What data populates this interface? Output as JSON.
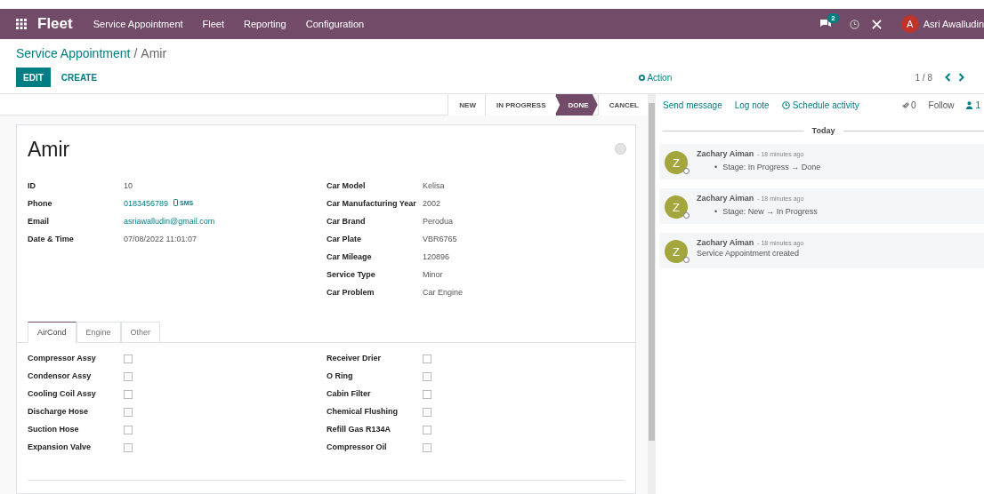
{
  "navbar": {
    "app_name": "Fleet",
    "menu": [
      "Service Appointment",
      "Fleet",
      "Reporting",
      "Configuration"
    ],
    "messages_badge": "2",
    "user": {
      "initial": "A",
      "name": "Asri Awalludin"
    }
  },
  "breadcrumb": {
    "parent": "Service Appointment",
    "separator": "/",
    "current": "Amir"
  },
  "buttons": [
    {
      "label": "EDIT",
      "kind": "primary"
    },
    {
      "label": "CREATE",
      "kind": "secondary"
    }
  ],
  "action": "Action",
  "pager": "1 / 8",
  "stages": [
    {
      "label": "NEW",
      "selected": false
    },
    {
      "label": "IN PROGRESS",
      "selected": false
    },
    {
      "label": "DONE",
      "selected": true
    },
    {
      "label": "CANCEL",
      "selected": false
    }
  ],
  "record": {
    "name": "Amir",
    "left_fields": [
      {
        "label": "ID",
        "value": "10",
        "kind": "text"
      },
      {
        "label": "Phone",
        "value": "0183456789",
        "kind": "phone",
        "extra": "SMS"
      },
      {
        "label": "Email",
        "value": "asriawalludin@gmail.com",
        "kind": "link"
      },
      {
        "label": "Date & Time",
        "value": "07/08/2022 11:01:07",
        "kind": "text"
      }
    ],
    "right_fields": [
      {
        "label": "Car Model",
        "value": "Kelisa",
        "kind": "text"
      },
      {
        "label": "Car Manufacturing Year",
        "value": "2002",
        "kind": "text"
      },
      {
        "label": "Car Brand",
        "value": "Perodua",
        "kind": "text"
      },
      {
        "label": "Car Plate",
        "value": "VBR6765",
        "kind": "text"
      },
      {
        "label": "Car Mileage",
        "value": "120896",
        "kind": "text"
      },
      {
        "label": "Service Type",
        "value": "Minor",
        "kind": "text"
      },
      {
        "label": "Car Problem",
        "value": "Car Engine",
        "kind": "text"
      }
    ]
  },
  "tabs": [
    {
      "label": "AirCond",
      "selected": true
    },
    {
      "label": "Engine",
      "selected": false
    },
    {
      "label": "Other",
      "selected": false
    }
  ],
  "checklist": {
    "left": [
      {
        "label": "Compressor Assy",
        "checked": false
      },
      {
        "label": "Condensor Assy",
        "checked": false
      },
      {
        "label": "Cooling Coil Assy",
        "checked": false
      },
      {
        "label": "Discharge Hose",
        "checked": false
      },
      {
        "label": "Suction Hose",
        "checked": false
      },
      {
        "label": "Expansion Valve",
        "checked": false
      }
    ],
    "right": [
      {
        "label": "Receiver Drier",
        "checked": false
      },
      {
        "label": "O Ring",
        "checked": false
      },
      {
        "label": "Cabin Filter",
        "checked": false
      },
      {
        "label": "Chemical Flushing",
        "checked": false
      },
      {
        "label": "Refill Gas R134A",
        "checked": false
      },
      {
        "label": "Compressor Oil",
        "checked": false
      }
    ]
  },
  "chatter": {
    "actions": [
      "Send message",
      "Log note"
    ],
    "schedule": "Schedule activity",
    "attachments": "0",
    "follow": "Follow",
    "followers": "1",
    "date": "Today",
    "messages": [
      {
        "avatar": "Z",
        "author": "Zachary Aiman",
        "time": "- 18 minutes ago",
        "kind": "tracking",
        "bullet": "•",
        "text": "Stage: In Progress → Done"
      },
      {
        "avatar": "Z",
        "author": "Zachary Aiman",
        "time": "- 18 minutes ago",
        "kind": "tracking",
        "bullet": "•",
        "text": "Stage: New → In Progress"
      },
      {
        "avatar": "Z",
        "author": "Zachary Aiman",
        "time": "- 18 minutes ago",
        "kind": "note",
        "text": "Service Appointment created"
      }
    ]
  }
}
